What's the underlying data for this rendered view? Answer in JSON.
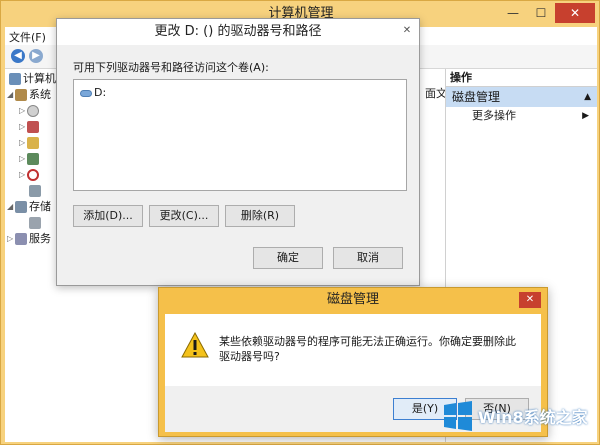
{
  "main_window": {
    "title": "计算机管理",
    "controls": [
      "—",
      "☐",
      "✕"
    ],
    "menu": [
      "文件(F)"
    ],
    "tree": [
      {
        "label": "计算机",
        "level": 0
      },
      {
        "label": "系统",
        "level": 1
      },
      {
        "label": "",
        "level": 2
      },
      {
        "label": "",
        "level": 2
      },
      {
        "label": "",
        "level": 2
      },
      {
        "label": "",
        "level": 2
      },
      {
        "label": "",
        "level": 2
      },
      {
        "label": "",
        "level": 2
      },
      {
        "label": "存储",
        "level": 1
      },
      {
        "label": "",
        "level": 2
      },
      {
        "label": "服务",
        "level": 1
      }
    ],
    "partial_text": "面文",
    "actions": {
      "header": "操作",
      "selected": "磁盘管理",
      "more": "更多操作"
    }
  },
  "change_dialog": {
    "title": "更改 D: () 的驱动器号和路径",
    "close": "✕",
    "label": "可用下列驱动器号和路径访问这个卷(A):",
    "items": [
      "D:"
    ],
    "buttons": {
      "add": "添加(D)...",
      "change": "更改(C)...",
      "remove": "删除(R)",
      "ok": "确定",
      "cancel": "取消"
    }
  },
  "confirm_dialog": {
    "title": "磁盘管理",
    "close": "✕",
    "message": "某些依赖驱动器号的程序可能无法正确运行。你确定要删除此驱动器号吗?",
    "buttons": {
      "yes": "是(Y)",
      "no": "否(N)"
    }
  },
  "watermark": {
    "text": "Win8系统之家"
  },
  "colors": {
    "accent": "#c7dcf3",
    "frame": "#f7d27e",
    "close_red": "#c7402e"
  }
}
